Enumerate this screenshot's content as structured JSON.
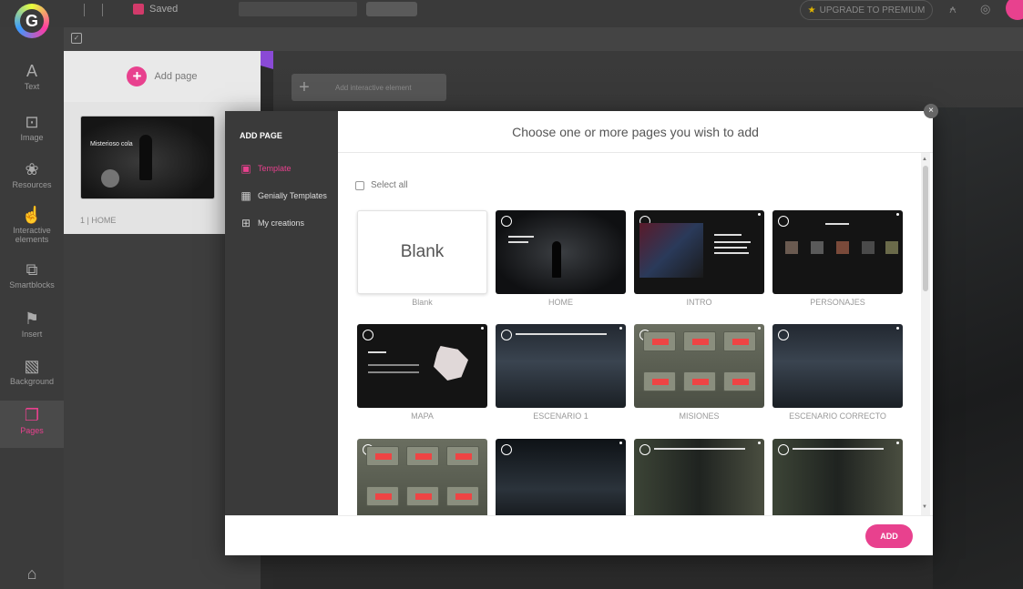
{
  "topbar": {
    "save_label": "Saved",
    "upgrade_label": "UPGRADE TO PREMIUM"
  },
  "sidebar": {
    "items": [
      {
        "label": "Text",
        "icon": "text-icon"
      },
      {
        "label": "Image",
        "icon": "image-icon"
      },
      {
        "label": "Resources",
        "icon": "resources-icon"
      },
      {
        "label": "Interactive elements",
        "icon": "interactive-icon"
      },
      {
        "label": "Smartblocks",
        "icon": "smartblocks-icon"
      },
      {
        "label": "Insert",
        "icon": "insert-icon"
      },
      {
        "label": "Background",
        "icon": "background-icon"
      },
      {
        "label": "Pages",
        "icon": "pages-icon"
      }
    ],
    "active": "Pages"
  },
  "pages_panel": {
    "add_page_label": "Add page",
    "pages": [
      {
        "label": "1 | HOME",
        "title": "Misterioso cola"
      }
    ]
  },
  "canvas": {
    "add_interactive_label": "Add interactive element"
  },
  "modal": {
    "header": "ADD PAGE",
    "menu": [
      {
        "label": "Template",
        "icon": "template-icon",
        "active": true
      },
      {
        "label": "Genially Templates",
        "icon": "grid-icon",
        "active": false
      },
      {
        "label": "My creations",
        "icon": "creations-icon",
        "active": false
      }
    ],
    "title": "Choose one or more pages you wish to add",
    "select_all_label": "Select all",
    "blank_text": "Blank",
    "tiles": [
      {
        "label": "Blank"
      },
      {
        "label": "HOME"
      },
      {
        "label": "INTRO"
      },
      {
        "label": "PERSONAJES"
      },
      {
        "label": "MAPA"
      },
      {
        "label": "ESCENARIO 1"
      },
      {
        "label": "MISIONES"
      },
      {
        "label": "ESCENARIO CORRECTO"
      },
      {
        "label": ""
      },
      {
        "label": ""
      },
      {
        "label": ""
      },
      {
        "label": ""
      }
    ],
    "add_button_label": "ADD",
    "close_label": "×"
  },
  "colors": {
    "accent": "#e8418e",
    "panel_dark": "#3a3a3a",
    "background": "#2b2b2b"
  }
}
